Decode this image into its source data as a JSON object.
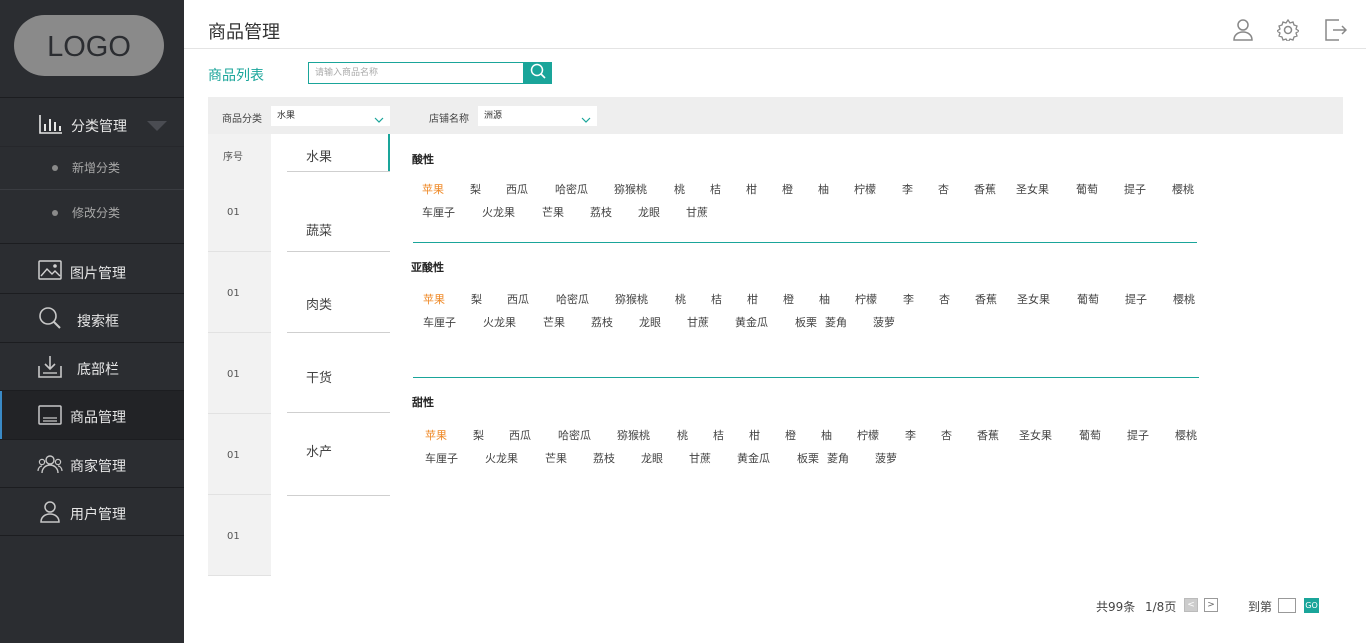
{
  "sidebar": {
    "logo": "LOGO",
    "items": [
      {
        "label": "分类管理"
      },
      {
        "label": "图片管理"
      },
      {
        "label": "搜索框"
      },
      {
        "label": "底部栏"
      },
      {
        "label": "商品管理"
      },
      {
        "label": "商家管理"
      },
      {
        "label": "用户管理"
      }
    ],
    "subitems": [
      {
        "label": "新增分类"
      },
      {
        "label": "修改分类"
      }
    ]
  },
  "header": {
    "title": "商品管理"
  },
  "list": {
    "title": "商品列表",
    "search_placeholder": "请输入商品名称"
  },
  "filters": {
    "category_label": "商品分类",
    "category_value": "水果",
    "shop_label": "店铺名称",
    "shop_value": "洲源"
  },
  "index": {
    "header": "序号",
    "rows": [
      "01",
      "01",
      "01",
      "01",
      "01"
    ]
  },
  "categories": [
    "水果",
    "蔬菜",
    "肉类",
    "干货",
    "水产"
  ],
  "groups": [
    {
      "title": "酸性",
      "tags": [
        "苹果",
        "梨",
        "西瓜",
        "哈密瓜",
        "猕猴桃",
        "桃",
        "桔",
        "柑",
        "橙",
        "柚",
        "柠檬",
        "李",
        "杏",
        "香蕉",
        "圣女果",
        "葡萄",
        "提子",
        "樱桃",
        "车厘子",
        "火龙果",
        "芒果",
        "荔枝",
        "龙眼",
        "甘蔗"
      ]
    },
    {
      "title": "亚酸性",
      "tags": [
        "苹果",
        "梨",
        "西瓜",
        "哈密瓜",
        "猕猴桃",
        "桃",
        "桔",
        "柑",
        "橙",
        "柚",
        "柠檬",
        "李",
        "杏",
        "香蕉",
        "圣女果",
        "葡萄",
        "提子",
        "樱桃",
        "车厘子",
        "火龙果",
        "芒果",
        "荔枝",
        "龙眼",
        "甘蔗",
        "黄金瓜",
        "板栗",
        "菱角",
        "菠萝"
      ]
    },
    {
      "title": "甜性",
      "tags": [
        "苹果",
        "梨",
        "西瓜",
        "哈密瓜",
        "猕猴桃",
        "桃",
        "桔",
        "柑",
        "橙",
        "柚",
        "柠檬",
        "李",
        "杏",
        "香蕉",
        "圣女果",
        "葡萄",
        "提子",
        "樱桃",
        "车厘子",
        "火龙果",
        "芒果",
        "荔枝",
        "龙眼",
        "甘蔗",
        "黄金瓜",
        "板栗",
        "菱角",
        "菠萝"
      ]
    }
  ],
  "pagination": {
    "total": "共99条",
    "page": "1/8页",
    "goto": "到第",
    "go": "GO",
    "prev": "<",
    "next": ">"
  },
  "colors": {
    "accent": "#1aa59a",
    "highlight": "#ef8a28",
    "sidebar_bg": "#2b2d31"
  }
}
